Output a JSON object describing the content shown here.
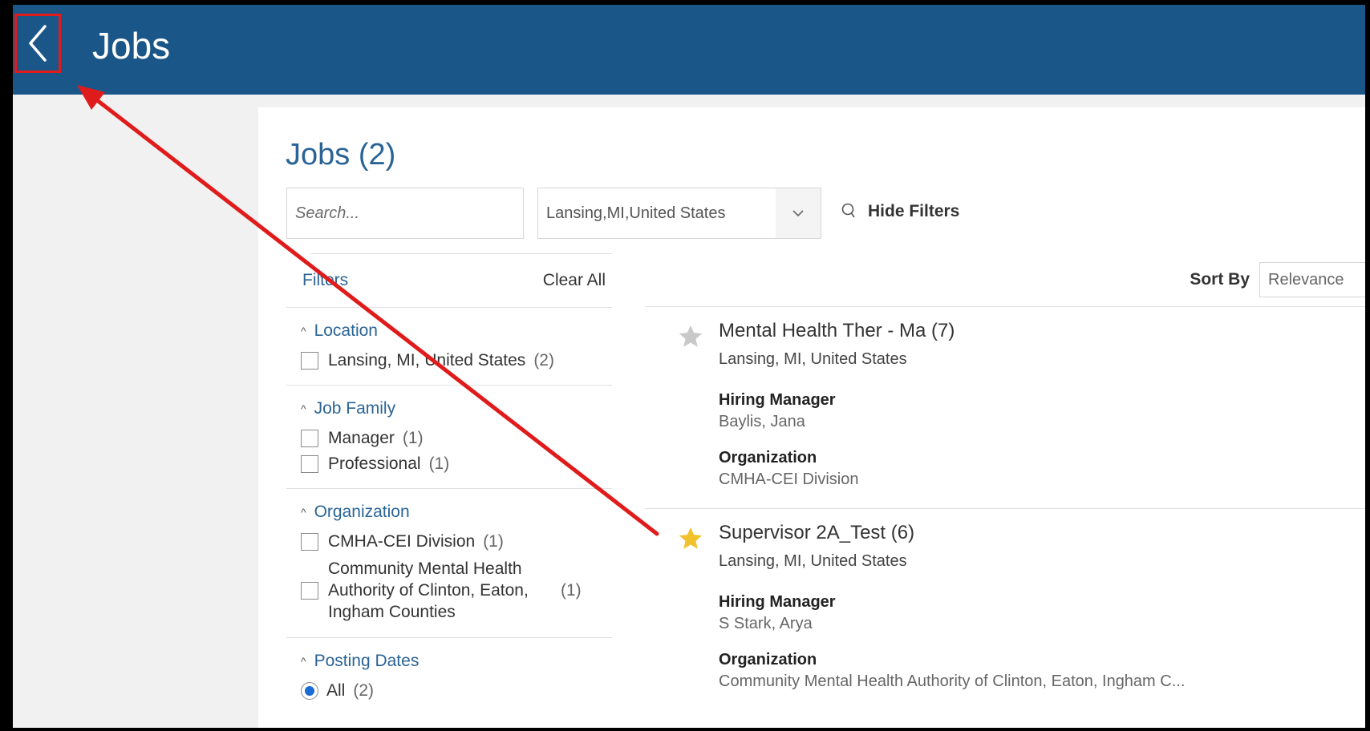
{
  "header": {
    "title": "Jobs"
  },
  "page": {
    "title": "Jobs (2)"
  },
  "search": {
    "placeholder": "Search..."
  },
  "location_select": {
    "value": "Lansing,MI,United States"
  },
  "hide_filters": {
    "label": "Hide Filters"
  },
  "filters": {
    "label": "Filters",
    "clear_all": "Clear All",
    "location": {
      "title": "Location",
      "options": [
        {
          "label": "Lansing, MI, United States",
          "count": "(2)"
        }
      ]
    },
    "job_family": {
      "title": "Job Family",
      "options": [
        {
          "label": "Manager",
          "count": "(1)"
        },
        {
          "label": "Professional",
          "count": "(1)"
        }
      ]
    },
    "organization": {
      "title": "Organization",
      "options": [
        {
          "label": "CMHA-CEI Division",
          "count": "(1)"
        },
        {
          "label": "Community Mental Health Authority of Clinton, Eaton, Ingham Counties",
          "count": "(1)"
        }
      ]
    },
    "posting_dates": {
      "title": "Posting Dates",
      "options": [
        {
          "label": "All",
          "count": "(2)",
          "selected": true
        }
      ]
    }
  },
  "sort": {
    "label": "Sort By",
    "value": "Relevance"
  },
  "jobs": [
    {
      "title": "Mental Health Ther - Ma (7)",
      "location": "Lansing, MI, United States",
      "hiring_manager_label": "Hiring Manager",
      "hiring_manager": "Baylis, Jana",
      "organization_label": "Organization",
      "organization": "CMHA-CEI Division",
      "favorite": false
    },
    {
      "title": "Supervisor 2A_Test (6)",
      "location": "Lansing, MI, United States",
      "hiring_manager_label": "Hiring Manager",
      "hiring_manager": "S Stark, Arya",
      "organization_label": "Organization",
      "organization": "Community Mental Health Authority of Clinton, Eaton, Ingham C...",
      "favorite": true
    }
  ],
  "colors": {
    "header_bg": "#1b5689",
    "accent": "#2a6496",
    "annotation": "#e01b1b",
    "star_active": "#f2c22e",
    "star_inactive": "#c9c9c9"
  },
  "icons": {
    "back": "chevron-left-icon",
    "search": "search-icon",
    "dropdown": "chevron-down-icon",
    "star": "star-icon"
  }
}
